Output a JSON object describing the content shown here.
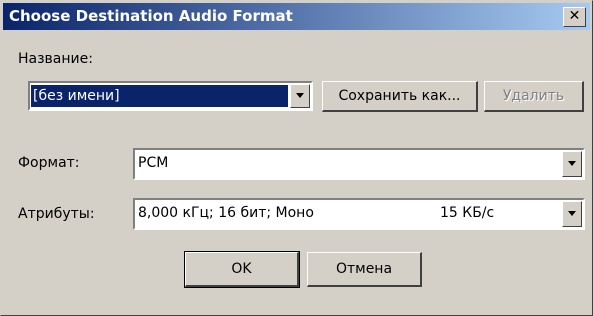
{
  "window": {
    "title": "Choose Destination Audio Format",
    "close_glyph": "✕"
  },
  "name": {
    "label": "Название:",
    "value": "[без имени]",
    "save_as_button": "Сохранить как...",
    "delete_button": "Удалить"
  },
  "format": {
    "label": "Формат:",
    "value": "PCM"
  },
  "attributes": {
    "label": "Атрибуты:",
    "value": "8,000 кГц; 16 бит; Моно",
    "rate": "15 КБ/с"
  },
  "buttons": {
    "ok": "OK",
    "cancel": "Отмена"
  },
  "colors": {
    "title_bar_start": "#0a246a",
    "title_bar_end": "#a6caf0",
    "dialog_bg": "#d4d0c8",
    "selection": "#0a246a"
  },
  "icons": {
    "dropdown": "chevron-down-icon",
    "close": "close-icon"
  }
}
